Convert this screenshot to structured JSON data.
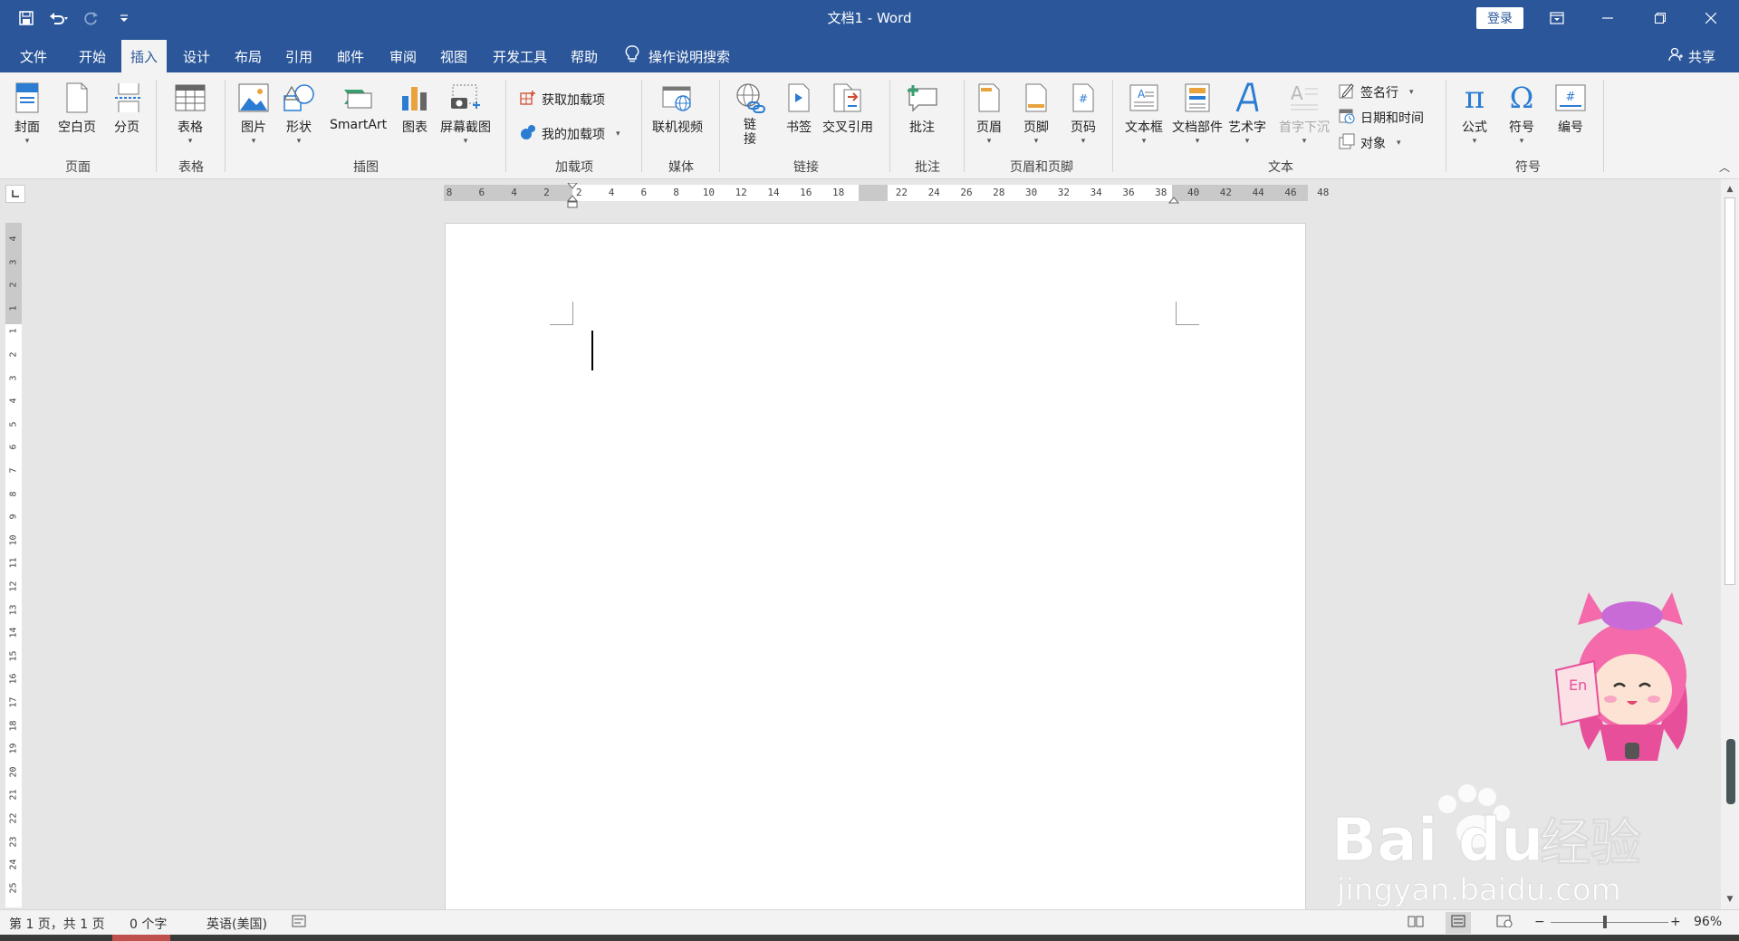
{
  "window": {
    "title": "文档1  -  Word",
    "login_label": "登录"
  },
  "menu": {
    "tabs": [
      "文件",
      "开始",
      "插入",
      "设计",
      "布局",
      "引用",
      "邮件",
      "审阅",
      "视图",
      "开发工具",
      "帮助"
    ],
    "active_tab": "插入",
    "tell_me": "操作说明搜索",
    "share": "共享"
  },
  "ribbon": {
    "groups": {
      "pages": "页面",
      "tables": "表格",
      "illustrations": "插图",
      "addins": "加载项",
      "media": "媒体",
      "links": "链接",
      "comments": "批注",
      "header_footer": "页眉和页脚",
      "text": "文本",
      "symbols": "符号"
    },
    "buttons": {
      "cover": "封面",
      "blank_page": "空白页",
      "page_break": "分页",
      "table": "表格",
      "picture": "图片",
      "shapes": "形状",
      "smartart": "SmartArt",
      "chart": "图表",
      "screenshot": "屏幕截图",
      "get_addins": "获取加载项",
      "my_addins": "我的加载项",
      "online_video": "联机视频",
      "link_1": "链",
      "link_2": "接",
      "bookmark": "书签",
      "cross_reference": "交叉引用",
      "comment": "批注",
      "header": "页眉",
      "footer": "页脚",
      "page_number": "页码",
      "text_box": "文本框",
      "quick_parts": "文档部件",
      "wordart": "艺术字",
      "drop_cap": "首字下沉",
      "signature_line": "签名行",
      "date_time": "日期和时间",
      "object": "对象",
      "equation": "公式",
      "symbol": "符号",
      "numbering": "编号"
    }
  },
  "rulers": {
    "horizontal_ticks": [
      "8",
      "6",
      "4",
      "2",
      "2",
      "4",
      "6",
      "8",
      "10",
      "12",
      "14",
      "16",
      "18",
      "22",
      "24",
      "26",
      "28",
      "30",
      "32",
      "34",
      "36",
      "38",
      "40",
      "42",
      "44",
      "46",
      "48"
    ],
    "vertical_ticks": [
      "4",
      "3",
      "2",
      "1",
      "1",
      "2",
      "3",
      "4",
      "5",
      "6",
      "7",
      "8",
      "9",
      "10",
      "11",
      "12",
      "13",
      "14",
      "15",
      "16",
      "17",
      "18",
      "19",
      "20",
      "21",
      "22",
      "23",
      "24",
      "25"
    ]
  },
  "statusbar": {
    "page_info": "第 1 页，共 1 页",
    "word_count": "0 个字",
    "language": "英语(美国)",
    "zoom_percent": "96%",
    "zoom_level": 0.46
  },
  "watermark": {
    "brand": "Bai",
    "brand_suffix": "du",
    "cn": "经验",
    "url": "jingyan.baidu.com",
    "mascot_badge": "En"
  },
  "colors": {
    "accent": "#2b579a",
    "ribbon_bg": "#f3f3f3",
    "canvas_bg": "#e6e6e6"
  }
}
